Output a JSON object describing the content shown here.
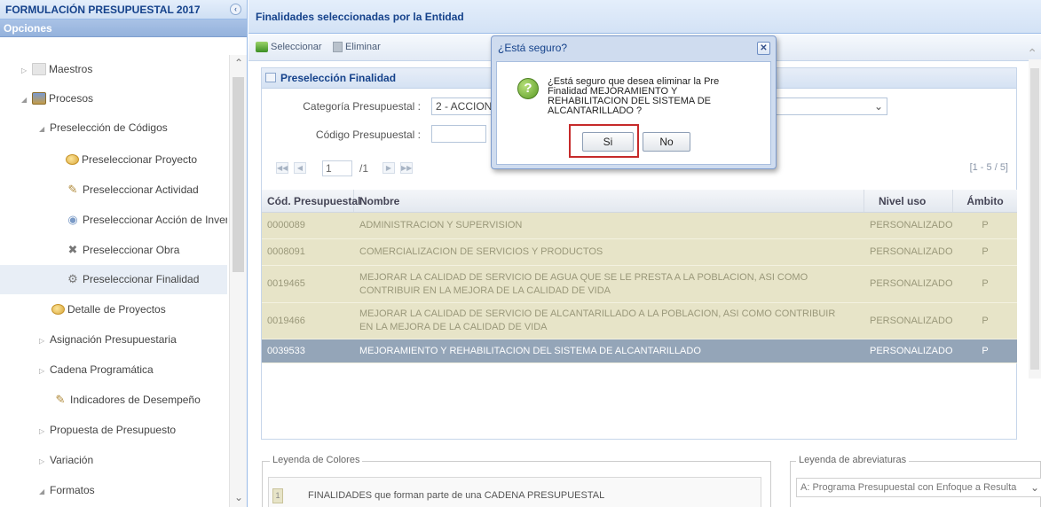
{
  "left_panel": {
    "title": "FORMULACIÓN PRESUPUESTAL 2017",
    "collapse_icon": "chevron-left-icon",
    "section": "Opciones",
    "tree": [
      {
        "label": "Maestros",
        "icon": "folder-icon"
      },
      {
        "label": "Procesos",
        "icon": "folder-open-icon"
      },
      {
        "label": "Preselección de Códigos",
        "icon": ""
      },
      {
        "label": "Preseleccionar Proyecto",
        "icon": "egg-icon"
      },
      {
        "label": "Preseleccionar Actividad",
        "icon": "activity-icon"
      },
      {
        "label": "Preseleccionar Acción de Inversión",
        "icon": "investment-icon"
      },
      {
        "label": "Preseleccionar Obra",
        "icon": "tools-icon"
      },
      {
        "label": "Preseleccionar Finalidad",
        "icon": "purpose-icon"
      },
      {
        "label": "Detalle de Proyectos",
        "icon": "egg-icon"
      },
      {
        "label": "Asignación Presupuestaria",
        "icon": ""
      },
      {
        "label": "Cadena Programática",
        "icon": ""
      },
      {
        "label": "Indicadores de Desempeño",
        "icon": "activity-icon"
      },
      {
        "label": "Propuesta de Presupuesto",
        "icon": ""
      },
      {
        "label": "Variación",
        "icon": ""
      },
      {
        "label": "Formatos",
        "icon": ""
      }
    ]
  },
  "right_panel": {
    "title": "Finalidades seleccionadas por la Entidad",
    "toolbar": {
      "select_label": "Seleccionar",
      "delete_label": "Eliminar"
    },
    "section_title": "Preselección Finalidad",
    "form": {
      "category_label": "Categoría Presupuestal :",
      "category_value": "2 - ACCION",
      "code_label": "Código Presupuestal :",
      "code_value": ""
    },
    "pager": {
      "page": "1",
      "total": "/1",
      "range": "[1 - 5 / 5]"
    },
    "grid": {
      "headers": [
        "Cód. Presupuestal",
        "Nombre",
        "Nivel uso",
        "Ámbito"
      ],
      "rows": [
        {
          "code": "0000089",
          "name": "ADMINISTRACION Y SUPERVISION",
          "level": "PERSONALIZADO",
          "scope": "P"
        },
        {
          "code": "0008091",
          "name": "COMERCIALIZACION DE SERVICIOS Y PRODUCTOS",
          "level": "PERSONALIZADO",
          "scope": "P"
        },
        {
          "code": "0019465",
          "name": "MEJORAR LA CALIDAD DE SERVICIO DE AGUA QUE SE LE PRESTA A LA POBLACION, ASI COMO CONTRIBUIR EN LA MEJORA DE LA CALIDAD DE VIDA",
          "level": "PERSONALIZADO",
          "scope": "P"
        },
        {
          "code": "0019466",
          "name": "MEJORAR LA CALIDAD DE SERVICIO DE ALCANTARILLADO A LA POBLACION, ASI COMO CONTRIBUIR EN LA MEJORA DE LA CALIDAD DE VIDA",
          "level": "PERSONALIZADO",
          "scope": "P"
        },
        {
          "code": "0039533",
          "name": "MEJORAMIENTO Y REHABILITACION DEL SISTEMA DE ALCANTARILLADO",
          "level": "PERSONALIZADO",
          "scope": "P"
        }
      ],
      "selected_index": 4
    },
    "legend": {
      "title": "Leyenda de Colores",
      "swatch": "1",
      "text": "FINALIDADES que forman parte de una CADENA PRESUPUESTAL"
    },
    "abbreviations": {
      "title": "Leyenda de abreviaturas",
      "selected": "A: Programa Presupuestal con Enfoque a Resulta"
    }
  },
  "dialog": {
    "title": "¿Está seguro?",
    "message": "¿Está seguro que desea eliminar la Pre Finalidad MEJORAMIENTO Y REHABILITACION DEL SISTEMA DE ALCANTARILLADO ?",
    "yes_label": "Si",
    "no_label": "No",
    "icon": "question-icon"
  },
  "colors": {
    "row_bg": "#e7e4c8",
    "selected_row_bg": "#94a5b8",
    "highlight": "#c62a2a",
    "header_text": "#15428b"
  }
}
